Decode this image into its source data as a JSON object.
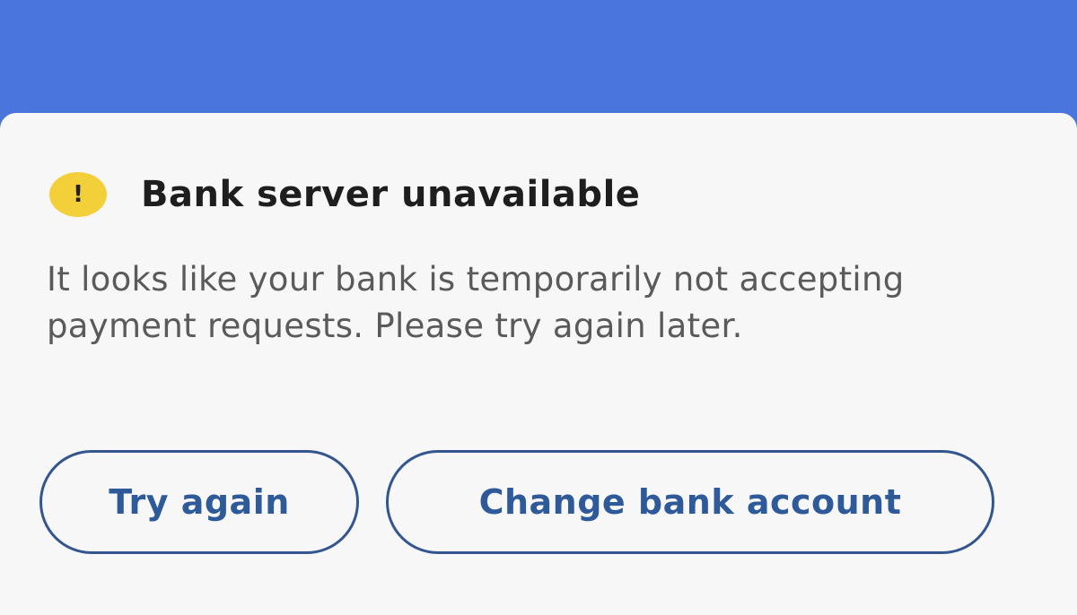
{
  "colors": {
    "header_blue": "#4a76dc",
    "sheet_background": "#f7f7f7",
    "warning_yellow": "#f3cf3a",
    "button_text_blue": "#2f5a9a",
    "button_border": "#33568f"
  },
  "alert": {
    "icon": "exclamation-warning-icon",
    "icon_glyph": "!",
    "title": "Bank server unavailable",
    "message": "It looks like your bank is temporarily not accepting payment requests. Please try again later."
  },
  "actions": {
    "try_again_label": "Try again",
    "change_bank_label": "Change bank account"
  }
}
